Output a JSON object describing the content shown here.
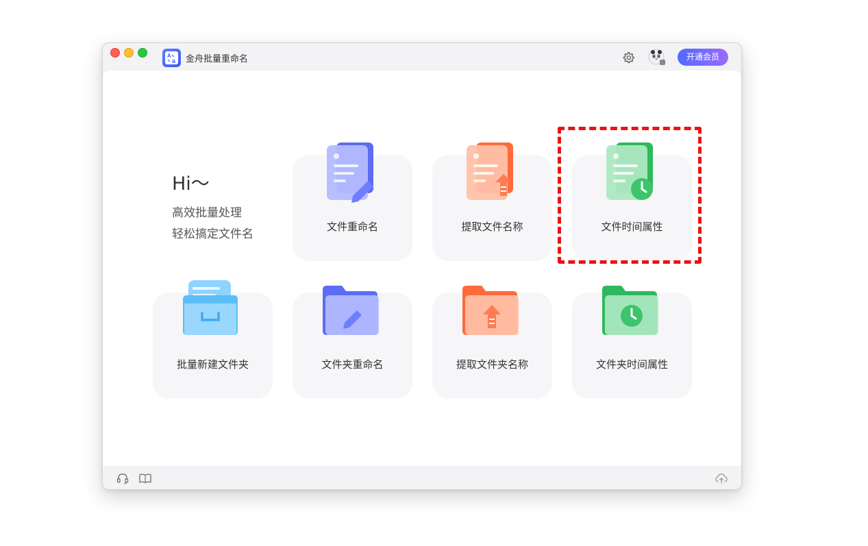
{
  "app": {
    "title": "金舟批量重命名",
    "vip_label": "开通会员"
  },
  "greeting": {
    "title": "Hi～",
    "line1": "高效批量处理",
    "line2": "轻松搞定文件名"
  },
  "tools": [
    {
      "label": "文件重命名",
      "icon": "document-edit-icon",
      "color": "#6f7dff"
    },
    {
      "label": "提取文件名称",
      "icon": "document-export-icon",
      "color": "#ff7b52"
    },
    {
      "label": "文件时间属性",
      "icon": "document-clock-icon",
      "color": "#3dc46c"
    },
    {
      "label": "批量新建文件夹",
      "icon": "folder-stack-icon",
      "color": "#3fa9f5"
    },
    {
      "label": "文件夹重命名",
      "icon": "folder-edit-icon",
      "color": "#6f7dff"
    },
    {
      "label": "提取文件夹名称",
      "icon": "folder-export-icon",
      "color": "#ff7b52"
    },
    {
      "label": "文件夹时间属性",
      "icon": "folder-clock-icon",
      "color": "#3dc46c"
    }
  ],
  "colors": {
    "accent_start": "#4f6bff",
    "accent_end": "#9b6bff",
    "highlight": "#ee1111"
  },
  "footer_icons": [
    "headset-icon",
    "book-icon",
    "cloud-upload-icon"
  ]
}
